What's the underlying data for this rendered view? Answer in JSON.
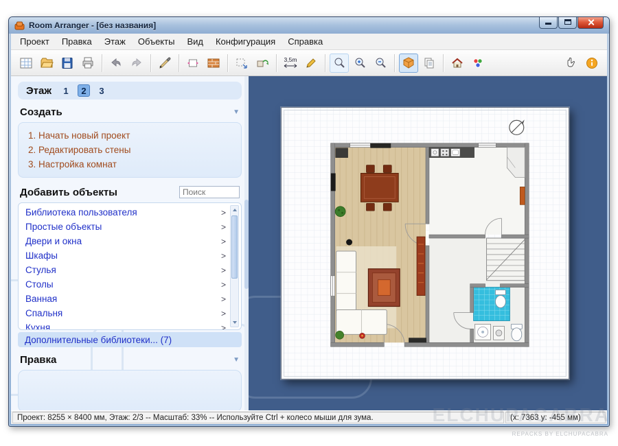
{
  "window": {
    "title": "Room Arranger - [без названия]"
  },
  "menu": {
    "items": [
      "Проект",
      "Правка",
      "Этаж",
      "Объекты",
      "Вид",
      "Конфигурация",
      "Справка"
    ]
  },
  "toolbar": {
    "measure_label": "3,5m"
  },
  "sidebar": {
    "floor": {
      "label": "Этаж",
      "buttons": [
        "1",
        "2",
        "3"
      ],
      "active": "2"
    },
    "create": {
      "title": "Создать",
      "items": [
        "1. Начать новый проект",
        "2. Редактировать стены",
        "3. Настройка комнат"
      ]
    },
    "objects": {
      "title": "Добавить объекты",
      "search_placeholder": "Поиск",
      "items": [
        "Библиотека пользователя",
        "Простые объекты",
        "Двери и окна",
        "Шкафы",
        "Стулья",
        "Столы",
        "Ванная",
        "Спальня",
        "Кухня"
      ],
      "more": "Дополнительные библиотеки... (7)"
    },
    "edit": {
      "title": "Правка"
    }
  },
  "statusbar": {
    "left": "Проект: 8255 × 8400 мм, Этаж: 2/3 -- Масштаб: 33% -- Используйте Ctrl + колесо мыши для зума.",
    "coords": "(x: 7363 y: -455 мм)"
  },
  "watermark": {
    "large": "ELCHUPACABRA",
    "small": "REPACKS BY ELCHUPACABRA"
  },
  "ui": {
    "collapse_arrow": "▼",
    "row_arrow": ">"
  },
  "colors": {
    "canvas": "#405d8a",
    "link_blue": "#2030c8",
    "link_brown": "#a04a1c",
    "tile_cyan": "#35bede",
    "accent": "#7fb0e8"
  }
}
